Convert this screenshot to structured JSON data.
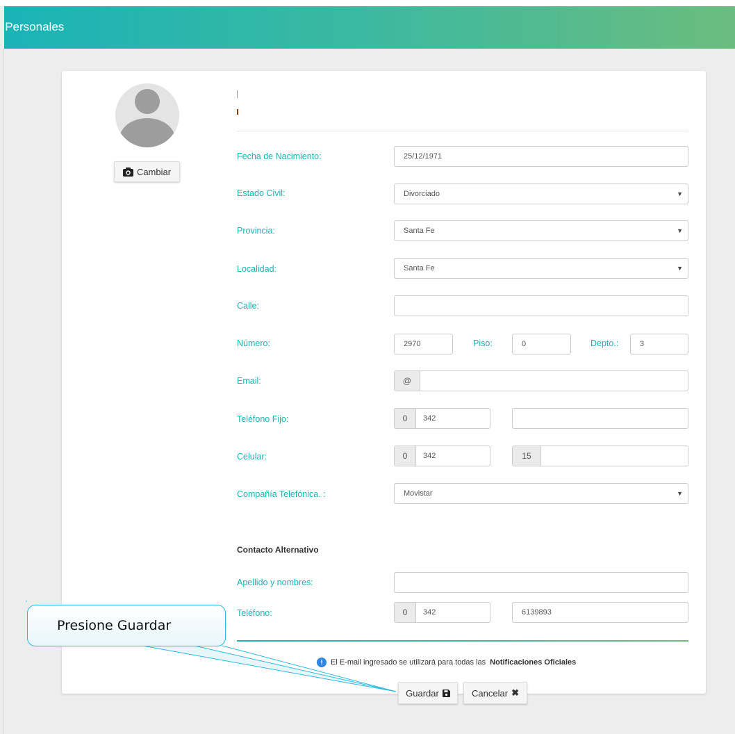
{
  "header": {
    "title": "s Personales"
  },
  "profile": {
    "change_photo_label": "Cambiar",
    "camera_icon": "camera-icon"
  },
  "form": {
    "fecha_nacimiento": {
      "label": "Fecha de Nacimiento:",
      "value": "25/12/1971"
    },
    "estado_civil": {
      "label": "Estado Civil:",
      "value": "Divorciado"
    },
    "provincia": {
      "label": "Provincia:",
      "value": "Santa Fe"
    },
    "localidad": {
      "label": "Localidad:",
      "value": "Santa Fe"
    },
    "calle": {
      "label": "Calle:",
      "value": ""
    },
    "numero": {
      "label": "Número:",
      "value": "2970"
    },
    "piso": {
      "label": "Piso:",
      "value": "0"
    },
    "depto": {
      "label": "Depto.:",
      "value": "3"
    },
    "email": {
      "label": "Email:",
      "addon": "@",
      "value": ""
    },
    "telefono_fijo": {
      "label": "Teléfono Fijo:",
      "prefix": "0",
      "area": "342",
      "number": ""
    },
    "celular": {
      "label": "Celular:",
      "prefix": "0",
      "area": "342",
      "prefix2": "15",
      "number": ""
    },
    "compania": {
      "label": "Compañía Telefónica. :",
      "value": "Movistar"
    }
  },
  "alt_contact": {
    "title": "Contacto Alternativo",
    "nombre": {
      "label": "Apellido y nombres:",
      "value": ""
    },
    "telefono": {
      "label": "Teléfono:",
      "prefix": "0",
      "area": "342",
      "number": "6139893"
    }
  },
  "notice": {
    "text_before": "El E-mail ingresado se utilizará para todas las",
    "text_bold": "Notificaciones Oficiales"
  },
  "actions": {
    "save_label": "Guardar",
    "cancel_label": "Cancelar"
  },
  "callout": {
    "text": "Presione Guardar"
  },
  "colors": {
    "accent": "#1ab3b7",
    "header_end": "#6bbc7e",
    "callout_border": "#29b9df"
  }
}
